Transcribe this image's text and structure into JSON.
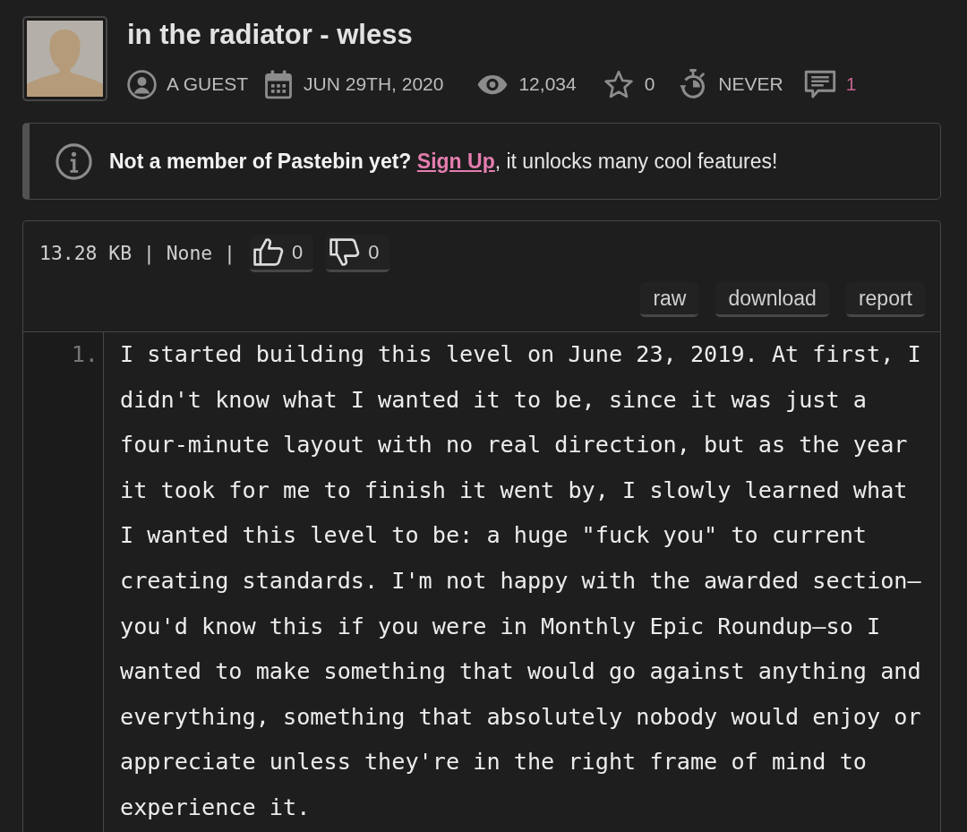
{
  "paste": {
    "title": "in the radiator - wless"
  },
  "meta": [
    {
      "kind": "author",
      "text": "A GUEST"
    },
    {
      "kind": "date",
      "text": "JUN 29TH, 2020"
    },
    {
      "kind": "views",
      "text": "12,034"
    },
    {
      "kind": "favorites",
      "text": "0"
    },
    {
      "kind": "expiry",
      "text": "NEVER"
    },
    {
      "kind": "comments",
      "text": "1"
    }
  ],
  "notice": {
    "lead": "Not a member of Pastebin yet?",
    "link": "Sign Up",
    "tail": ", it unlocks many cool features!"
  },
  "info": "13.28 KB | None |",
  "votes": [
    {
      "kind": "like",
      "count": "0"
    },
    {
      "kind": "dislike",
      "count": "0"
    }
  ],
  "actions": [
    "raw",
    "download",
    "report"
  ],
  "lines": [
    {
      "number": "1.",
      "text": "I started building this level on June 23, 2019. At first, I didn't know what I wanted it to be, since it was just a four-minute layout with no real direction, but as the year it took for me to finish it went by, I slowly learned what I wanted this level to be: a huge \"fuck you\" to current creating standards. I'm not happy with the awarded section—you'd know this if you were in Monthly Epic Roundup—so I wanted to make something that would go against anything and everything, something that absolutely nobody would enjoy or appreciate unless they're in the right frame of mind to experience it."
    }
  ]
}
